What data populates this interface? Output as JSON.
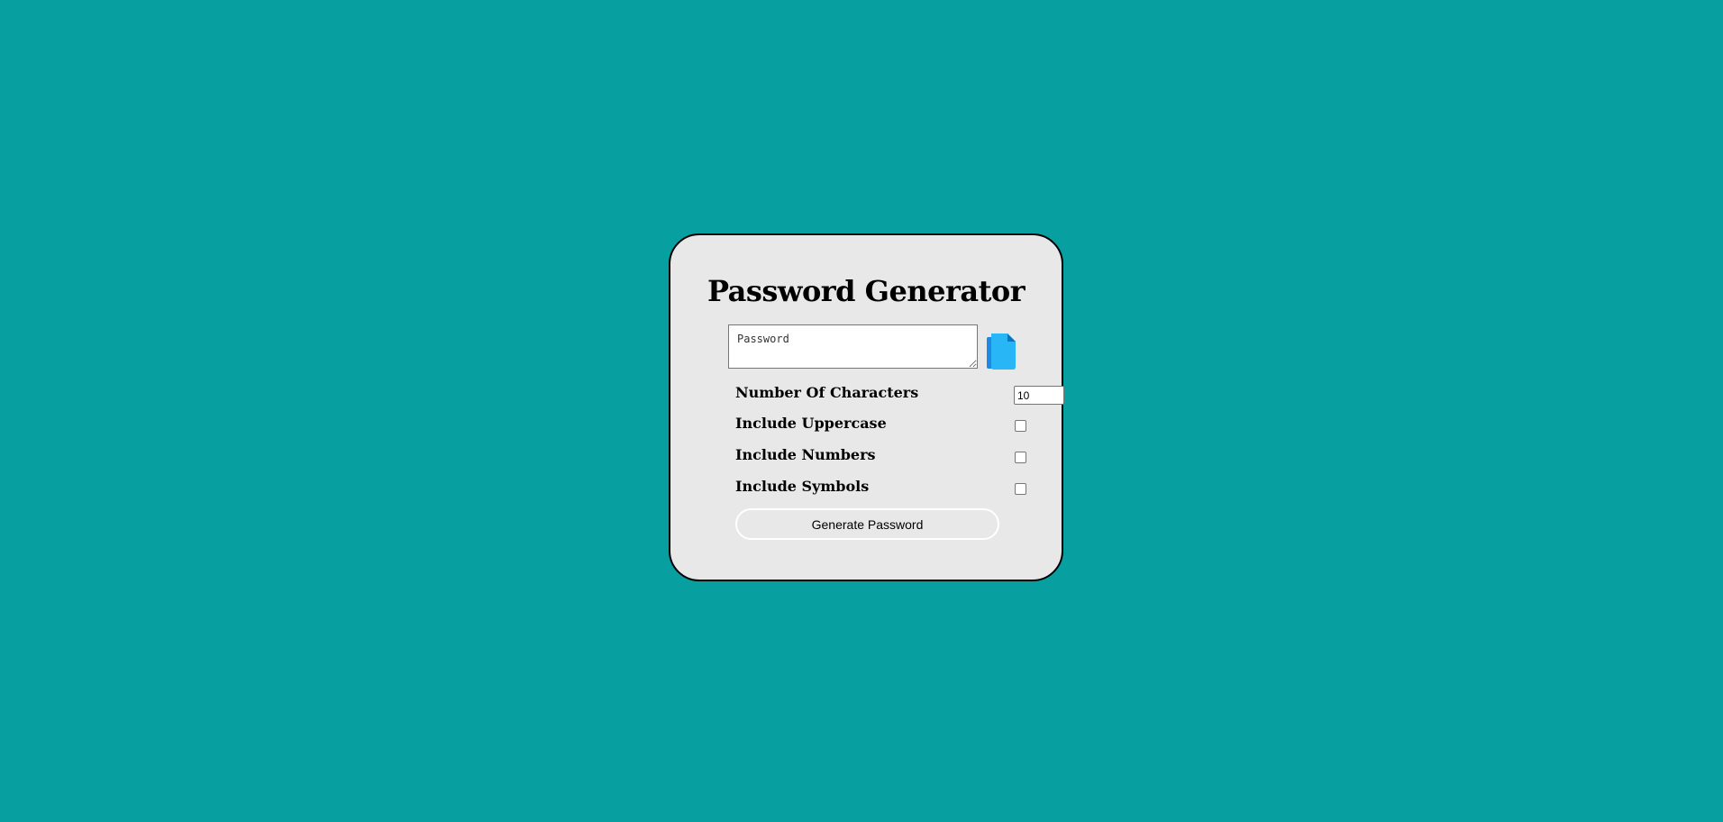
{
  "app": {
    "title": "Password Generator"
  },
  "password_field": {
    "placeholder": "Password",
    "value": ""
  },
  "copy_button": {
    "icon": "copy-icon",
    "colors": {
      "front": "#29b6f6",
      "back": "#1e88e5",
      "fold": "#0277bd"
    }
  },
  "options": {
    "length": {
      "label": "Number Of Characters",
      "value": "10"
    },
    "uppercase": {
      "label": "Include Uppercase",
      "checked": false
    },
    "numbers": {
      "label": "Include Numbers",
      "checked": false
    },
    "symbols": {
      "label": "Include Symbols",
      "checked": false
    }
  },
  "generate_button": {
    "label": "Generate Password"
  },
  "colors": {
    "background": "#089fa1",
    "card": "#e8e8e8",
    "card_border": "#000000"
  }
}
